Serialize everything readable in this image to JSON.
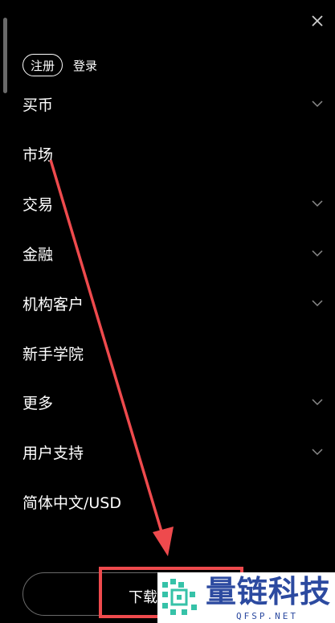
{
  "header": {
    "close_icon": "close-icon"
  },
  "auth": {
    "register_label": "注册",
    "login_label": "登录"
  },
  "menu": {
    "items": [
      {
        "label": "买币",
        "has_submenu": true
      },
      {
        "label": "市场",
        "has_submenu": false
      },
      {
        "label": "交易",
        "has_submenu": true
      },
      {
        "label": "金融",
        "has_submenu": true
      },
      {
        "label": "机构客户",
        "has_submenu": true
      },
      {
        "label": "新手学院",
        "has_submenu": false
      },
      {
        "label": "更多",
        "has_submenu": true
      },
      {
        "label": "用户支持",
        "has_submenu": true
      },
      {
        "label": "简体中文/USD",
        "has_submenu": false
      }
    ]
  },
  "download": {
    "label": "下载"
  },
  "annotation": {
    "color": "#ee4a4d"
  },
  "watermark": {
    "title": "量链科技",
    "subtitle": "QFSP.NET",
    "color": "#2c4aa0"
  }
}
